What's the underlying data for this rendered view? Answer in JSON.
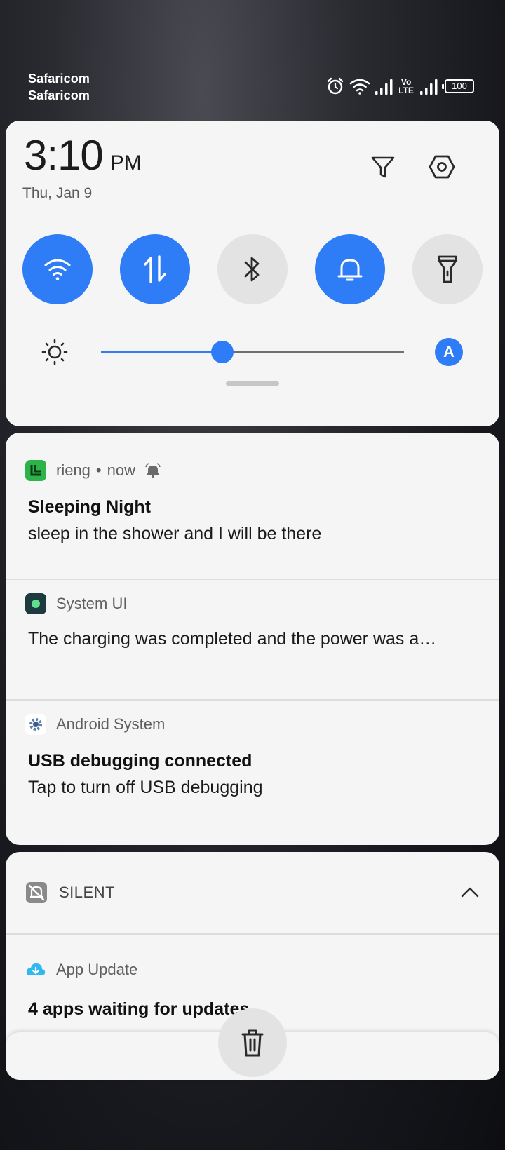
{
  "status_bar": {
    "carrier_1": "Safaricom",
    "carrier_2": "Safaricom",
    "icons": [
      "alarm-icon",
      "wifi-icon",
      "signal-icon",
      "volte-icon",
      "signal-icon",
      "battery-icon"
    ],
    "volte_top": "Vo",
    "volte_bottom": "LTE",
    "battery_level": "100"
  },
  "quick_settings": {
    "time": "3:10",
    "ampm": "PM",
    "date": "Thu, Jan 9",
    "top_icons": [
      "filter-icon",
      "settings-icon"
    ],
    "tiles": [
      {
        "name": "wifi",
        "icon": "wifi-icon",
        "active": true
      },
      {
        "name": "mobile-data",
        "icon": "data-arrows-icon",
        "active": true
      },
      {
        "name": "bluetooth",
        "icon": "bluetooth-icon",
        "active": false
      },
      {
        "name": "sound",
        "icon": "bell-icon",
        "active": true
      },
      {
        "name": "flashlight",
        "icon": "flashlight-icon",
        "active": false
      }
    ],
    "brightness_fraction": 0.4,
    "auto_brightness_label": "A",
    "accent_color": "#2e7cf6"
  },
  "notifications": [
    {
      "app": "rieng",
      "time": "now",
      "title": "Sleeping Night",
      "body": "sleep in the shower and I will be there",
      "icon": "rieng-app-icon",
      "has_bell": true
    },
    {
      "app": "System UI",
      "title": "",
      "body": "The charging was completed and the power was a…",
      "icon": "system-ui-icon"
    },
    {
      "app": "Android System",
      "title": "USB debugging connected",
      "body": "Tap to turn off USB debugging",
      "icon": "android-system-icon"
    }
  ],
  "silent_section": {
    "label": "SILENT",
    "notifications": [
      {
        "app": "App Update",
        "title": "4 apps waiting for updates",
        "icon": "app-update-icon"
      }
    ]
  },
  "clear_all_icon": "trash-icon"
}
